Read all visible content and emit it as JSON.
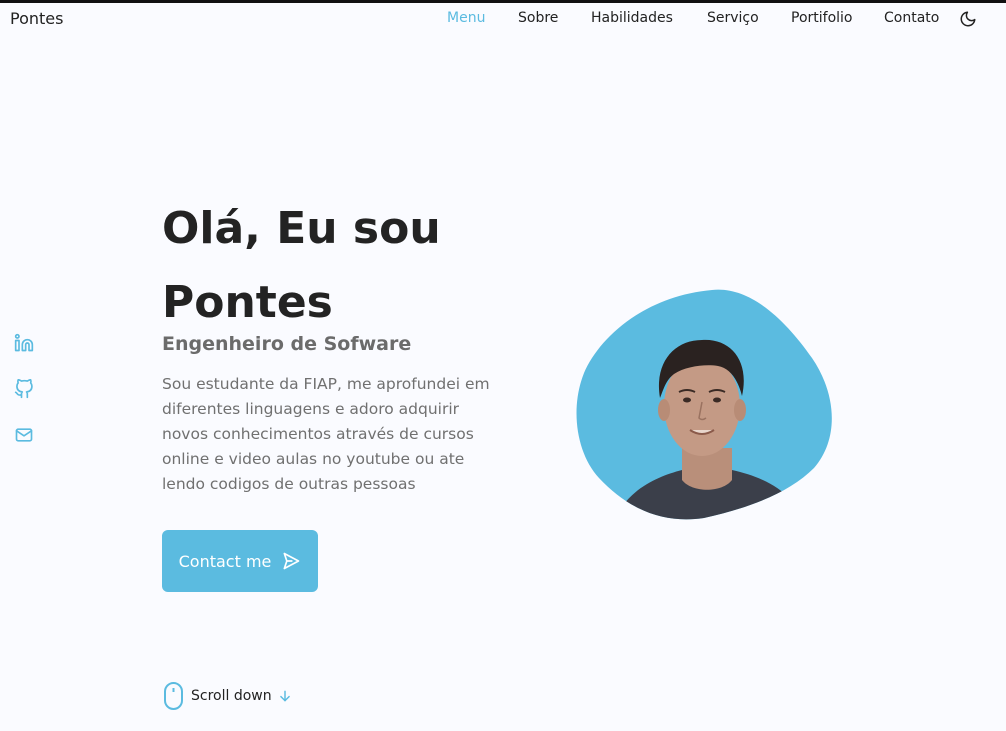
{
  "header": {
    "logo": "Pontes",
    "nav": [
      {
        "label": "Menu",
        "active": true
      },
      {
        "label": "Sobre",
        "active": false
      },
      {
        "label": "Habilidades",
        "active": false
      },
      {
        "label": "Serviço",
        "active": false
      },
      {
        "label": "Portifolio",
        "active": false
      },
      {
        "label": "Contato",
        "active": false
      }
    ],
    "theme_icon": "moon-icon"
  },
  "social": [
    {
      "icon": "linkedin-icon"
    },
    {
      "icon": "github-icon"
    },
    {
      "icon": "mail-icon"
    }
  ],
  "hero": {
    "title_line1": "Olá, Eu sou",
    "title_line2": "Pontes",
    "subtitle": "Engenheiro de Sofware",
    "description": "Sou estudante da FIAP, me aprofundei em diferentes linguagens e adoro adquirir novos conhecimentos através de cursos online e video aulas no youtube ou ate lendo codigos de outras pessoas",
    "button_label": "Contact me",
    "button_icon": "send-icon"
  },
  "scroll": {
    "label": "Scroll down",
    "mouse_icon": "mouse-icon",
    "arrow_icon": "arrow-down-icon"
  },
  "colors": {
    "accent": "#5bbbe0",
    "background": "#fafbff",
    "text": "#232323"
  }
}
